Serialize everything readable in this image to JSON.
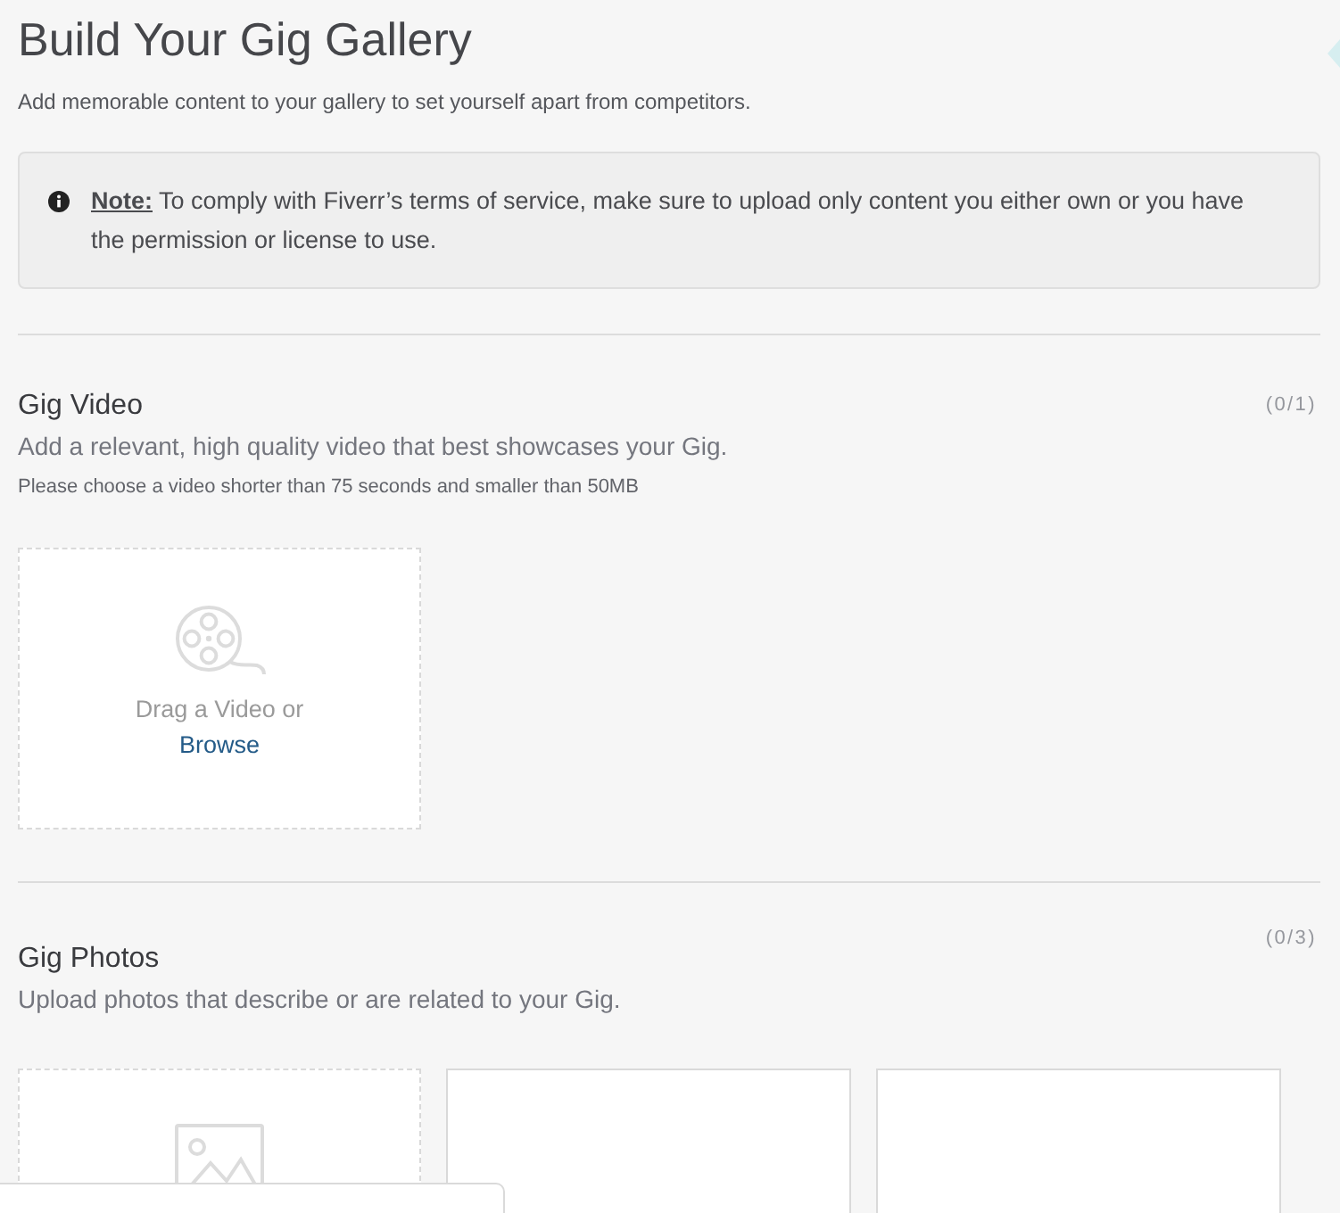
{
  "page": {
    "title": "Build Your Gig Gallery",
    "subtitle": "Add memorable content to your gallery to set yourself apart from competitors."
  },
  "note": {
    "text": "**Note:** To comply with Fiverr’s terms of service, make sure to upload only content you either own or you have the permission or license to use."
  },
  "sections": [
    {
      "kind": "video",
      "title": "Gig Video",
      "count": "(0/1)",
      "description": "Add a relevant, high quality video that best showcases your Gig.",
      "hint": "Please choose a video shorter than 75 seconds and smaller than 50MB",
      "slots": [
        {
          "kind": "dropzone",
          "prompt": "Drag a Video or",
          "link": "Browse"
        }
      ]
    },
    {
      "kind": "photos",
      "title": "Gig Photos",
      "count": "(0/3)",
      "description": "Upload photos that describe or are related to your Gig.",
      "slots": [
        {
          "kind": "dropzone"
        },
        {
          "kind": "empty"
        },
        {
          "kind": "empty"
        }
      ]
    }
  ]
}
